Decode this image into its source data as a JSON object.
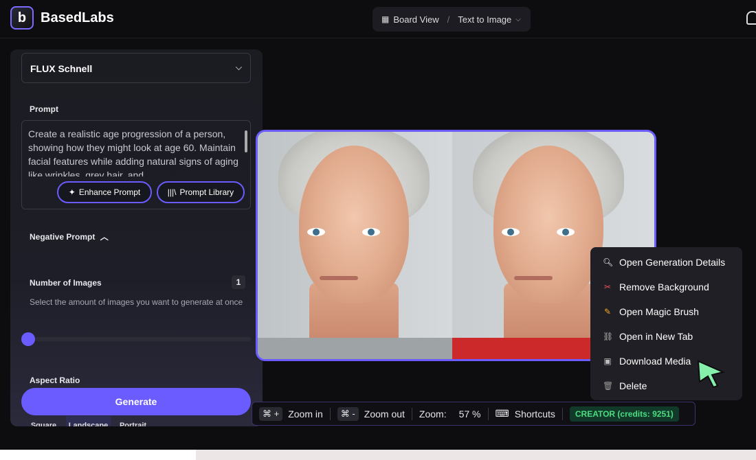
{
  "header": {
    "brand": "BasedLabs",
    "logo_letter": "b",
    "board_view": "Board View",
    "separator": "/",
    "current_page": "Text to Image"
  },
  "panel": {
    "model": "FLUX Schnell",
    "prompt_label": "Prompt",
    "prompt_text": "Create a realistic age progression of a person, showing how they might look at age 60. Maintain facial features while adding natural signs of aging like wrinkles, grey hair, and",
    "enhance_label": "Enhance Prompt",
    "library_label": "Prompt Library",
    "negative_label": "Negative Prompt",
    "num_images_label": "Number of Images",
    "num_images_value": "1",
    "num_images_helper": "Select the amount of images you want to generate at once",
    "aspect_label": "Aspect Ratio",
    "generate_label": "Generate",
    "ratios": [
      "Square",
      "Landscape",
      "Portrait"
    ]
  },
  "menu": {
    "items": [
      {
        "label": "Open Generation Details",
        "icon": "magnifier-icon"
      },
      {
        "label": "Remove Background",
        "icon": "scissors-icon"
      },
      {
        "label": "Open Magic Brush",
        "icon": "pencil-icon"
      },
      {
        "label": "Open in New Tab",
        "icon": "link-icon"
      },
      {
        "label": "Download Media",
        "icon": "floppy-icon"
      },
      {
        "label": "Delete",
        "icon": "trash-icon"
      }
    ]
  },
  "zoombar": {
    "zoom_in_key": "+",
    "zoom_in_label": "Zoom in",
    "zoom_out_key": "-",
    "zoom_out_label": "Zoom out",
    "zoom_label": "Zoom:",
    "zoom_value": "57 %",
    "shortcuts_label": "Shortcuts",
    "credits_label": "CREATOR (credits: 9251)"
  },
  "colors": {
    "accent": "#6b5cff",
    "credits_green": "#4ade80"
  }
}
